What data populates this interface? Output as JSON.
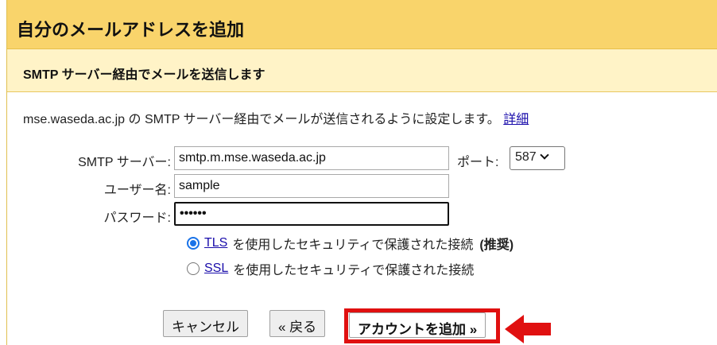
{
  "dialog": {
    "title": "自分のメールアドレスを追加",
    "subtitle": "SMTP サーバー経由でメールを送信します",
    "description": "mse.waseda.ac.jp の SMTP サーバー経由でメールが送信されるように設定します。",
    "details_link": "詳細"
  },
  "form": {
    "smtp_label": "SMTP サーバー:",
    "smtp_value": "smtp.m.mse.waseda.ac.jp",
    "port_label": "ポート:",
    "port_value": "587",
    "username_label": "ユーザー名:",
    "username_value": "sample",
    "password_label": "パスワード:",
    "password_value": "••••••"
  },
  "security": {
    "tls_link": "TLS",
    "tls_text": "を使用したセキュリティで保護された接続",
    "tls_recommended": "(推奨)",
    "ssl_link": "SSL",
    "ssl_text": "を使用したセキュリティで保護された接続",
    "selected": "TLS"
  },
  "buttons": {
    "cancel": "キャンセル",
    "back": "« 戻る",
    "add_account": "アカウントを追加 »"
  },
  "colors": {
    "title_bar": "#f9d46b",
    "sub_bar": "#fff3c7",
    "highlight": "#e01010",
    "radio_accent": "#1a73e8"
  },
  "icons": {
    "annotation_arrow": "red-left-arrow-icon",
    "port_dropdown": "chevron-down-icon"
  }
}
